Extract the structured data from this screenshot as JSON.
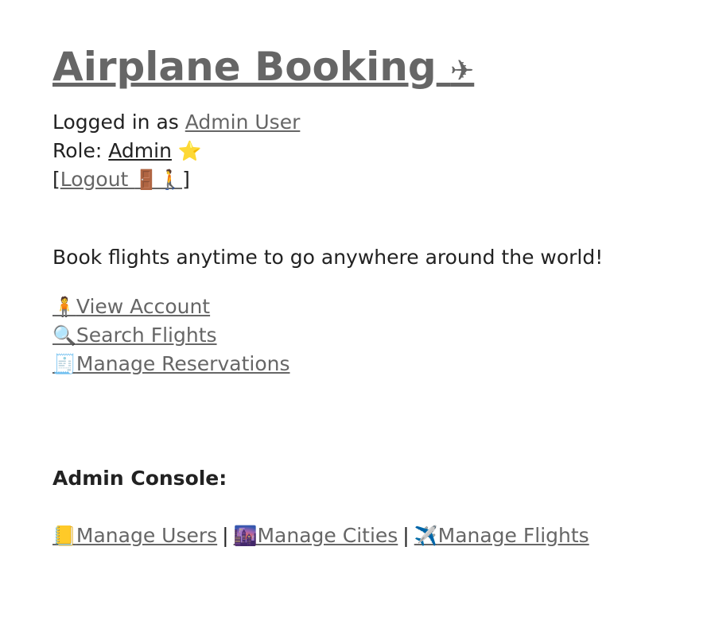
{
  "header": {
    "title": "Airplane Booking",
    "title_icon": "✈"
  },
  "user": {
    "logged_in_prefix": "Logged in as ",
    "user_name": "Admin User",
    "role_prefix": "Role: ",
    "role": "Admin",
    "role_icon": "⭐",
    "logout_open": "[",
    "logout_label": "Logout ",
    "logout_icons": "🚪🚶",
    "logout_close": "]"
  },
  "tagline": "Book flights anytime to go anywhere around the world!",
  "nav": {
    "items": [
      {
        "icon": "🧍",
        "label": "View Account"
      },
      {
        "icon": "🔍",
        "label": "Search Flights"
      },
      {
        "icon": "🧾",
        "label": "Manage Reservations"
      }
    ]
  },
  "admin": {
    "heading": "Admin Console:",
    "separator": "|",
    "links": [
      {
        "icon": "📒",
        "label": "Manage Users"
      },
      {
        "icon": "🌆",
        "label": "Manage Cities"
      },
      {
        "icon": "✈️",
        "label": "Manage Flights"
      }
    ]
  },
  "colors": {
    "link": "#666666",
    "text": "#222222",
    "background": "#ffffff"
  }
}
